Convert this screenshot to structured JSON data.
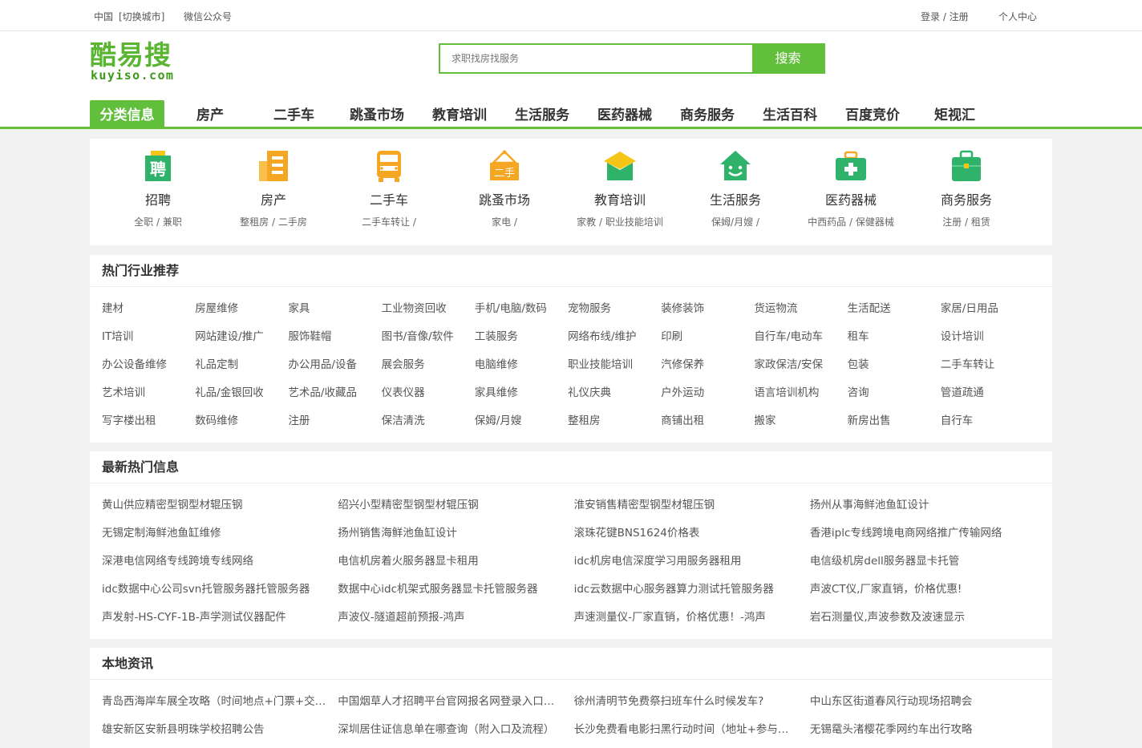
{
  "topbar": {
    "city": "中国",
    "switch_city": "[切换城市]",
    "wechat": "微信公众号",
    "login_register": "登录 / 注册",
    "user_center": "个人中心"
  },
  "logo": {
    "cn": "酷易搜",
    "en": "kuyiso.com"
  },
  "search": {
    "placeholder": "求职找房找服务",
    "button": "搜索"
  },
  "nav": [
    "分类信息",
    "房产",
    "二手车",
    "跳蚤市场",
    "教育培训",
    "生活服务",
    "医药器械",
    "商务服务",
    "生活百科",
    "百度竞价",
    "矩视汇"
  ],
  "categories": [
    {
      "name": "招聘",
      "subs": "全职 / 兼职",
      "icon": "recruit-icon",
      "color": "#2fb36b"
    },
    {
      "name": "房产",
      "subs": "整租房 /  二手房",
      "icon": "building-icon",
      "color": "#f5a623"
    },
    {
      "name": "二手车",
      "subs": "二手车转让 /",
      "icon": "car-icon",
      "color": "#f5a623"
    },
    {
      "name": "跳蚤市场",
      "subs": "家电 /",
      "icon": "secondhand-sign-icon",
      "color": "#f5a623"
    },
    {
      "name": "教育培训",
      "subs": "家教 /  职业技能培训",
      "icon": "graduation-cap-icon",
      "color": "#2fb36b"
    },
    {
      "name": "生活服务",
      "subs": "保姆/月嫂 /",
      "icon": "smiley-house-icon",
      "color": "#2fb36b"
    },
    {
      "name": "医药器械",
      "subs": "中西药品 /  保健器械",
      "icon": "medical-kit-icon",
      "color": "#2fb36b"
    },
    {
      "name": "商务服务",
      "subs": "注册 /  租赁",
      "icon": "briefcase-icon",
      "color": "#2fb36b"
    }
  ],
  "hot_industries": {
    "title": "热门行业推荐",
    "items": [
      "建材",
      "房屋维修",
      "家具",
      "工业物资回收",
      "手机/电脑/数码",
      "宠物服务",
      "装修装饰",
      "货运物流",
      "生活配送",
      "家居/日用品",
      "IT培训",
      "网站建设/推广",
      "服饰鞋帽",
      "图书/音像/软件",
      "工装服务",
      "网络布线/维护",
      "印刷",
      "自行车/电动车",
      "租车",
      "设计培训",
      "办公设备维修",
      "礼品定制",
      "办公用品/设备",
      "展会服务",
      "电脑维修",
      "职业技能培训",
      "汽修保养",
      "家政保洁/安保",
      "包装",
      "二手车转让",
      "艺术培训",
      "礼品/金银回收",
      "艺术品/收藏品",
      "仪表仪器",
      "家具维修",
      "礼仪庆典",
      "户外运动",
      "语言培训机构",
      "咨询",
      "管道疏通",
      "写字楼出租",
      "数码维修",
      "注册",
      "保洁清洗",
      "保姆/月嫂",
      "整租房",
      "商铺出租",
      "搬家",
      "新房出售",
      "自行车"
    ]
  },
  "latest_hot": {
    "title": "最新热门信息",
    "items": [
      "黄山供应精密型钢型材辊压钢",
      "绍兴小型精密型钢型材辊压钢",
      "淮安销售精密型钢型材辊压钢",
      "扬州从事海鲜池鱼缸设计",
      "无锡定制海鲜池鱼缸维修",
      "扬州销售海鲜池鱼缸设计",
      "滚珠花键BNS1624价格表",
      "香港iplc专线跨境电商网络推广传输网络",
      "深港电信网络专线跨境专线网络",
      "电信机房着火服务器显卡租用",
      "idc机房电信深度学习用服务器租用",
      "电信级机房dell服务器显卡托管",
      "idc数据中心公司svn托管服务器托管服务器",
      "数据中心idc机架式服务器显卡托管服务器",
      "idc云数据中心服务器算力测试托管服务器",
      "声波CT仪,厂家直销，价格优惠!",
      "声发射-HS-CYF-1B-声学测试仪器配件",
      "声波仪-隧道超前预报-鸿声",
      "声速测量仪-厂家直销，价格优惠！-鸿声",
      "岩石测量仪,声波参数及波速显示"
    ]
  },
  "local_news": {
    "title": "本地资讯",
    "items": [
      "青岛西海岸车展全攻略（时间地点+门票+交通）",
      "中国烟草人才招聘平台官网报名网登录入口及流程",
      "徐州清明节免费祭扫班车什么时候发车?",
      "中山东区街道春风行动现场招聘会",
      "雄安新区安新县明珠学校招聘公告",
      "深圳居住证信息单在哪查询（附入口及流程）",
      "长沙免费看电影扫黑行动时间（地址+参与方式）",
      "无锡鼋头渚樱花季网约车出行攻略"
    ]
  }
}
